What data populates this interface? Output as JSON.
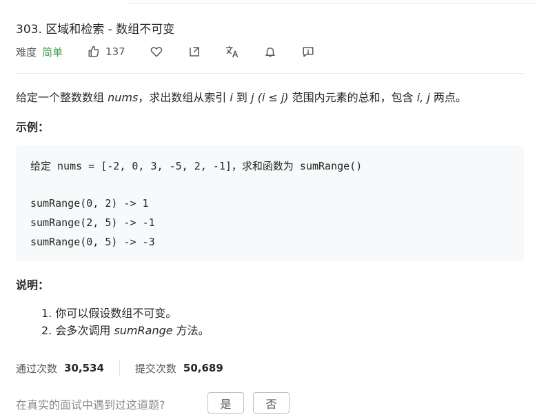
{
  "problem": {
    "title": "303. 区域和检索 - 数组不可变",
    "difficulty_label": "难度",
    "difficulty": "简单",
    "likes": "137",
    "toolbar_icons": [
      "thumbs-up-icon",
      "heart-icon",
      "share-icon",
      "translate-icon",
      "bell-icon",
      "feedback-icon"
    ]
  },
  "description": {
    "prefix": "给定一个整数数组 ",
    "nums": "nums",
    "mid": "，求出数组从索引 ",
    "i": "i",
    "to": " 到 ",
    "j": "j",
    "range": " (i ≤ j)",
    "suffix": " 范围内元素的总和，包含 ",
    "ij": "i,  j",
    "end": " 两点。"
  },
  "example": {
    "heading": "示例：",
    "lines": [
      "给定 nums = [-2, 0, 3, -5, 2, -1]，求和函数为 sumRange()",
      "",
      "sumRange(0, 2) -> 1",
      "sumRange(2, 5) -> -1",
      "sumRange(0, 5) -> -3"
    ]
  },
  "notes": {
    "heading": "说明：",
    "item1": "1. 你可以假设数组不可变。",
    "item2_prefix": "2. 会多次调用 ",
    "item2_method": "sumRange",
    "item2_suffix": " 方法。"
  },
  "stats": {
    "accepted_label": "通过次数",
    "accepted": "30,534",
    "submissions_label": "提交次数",
    "submissions": "50,689"
  },
  "interview": {
    "question": "在真实的面试中遇到过这道题?",
    "yes": "是",
    "no": "否"
  }
}
